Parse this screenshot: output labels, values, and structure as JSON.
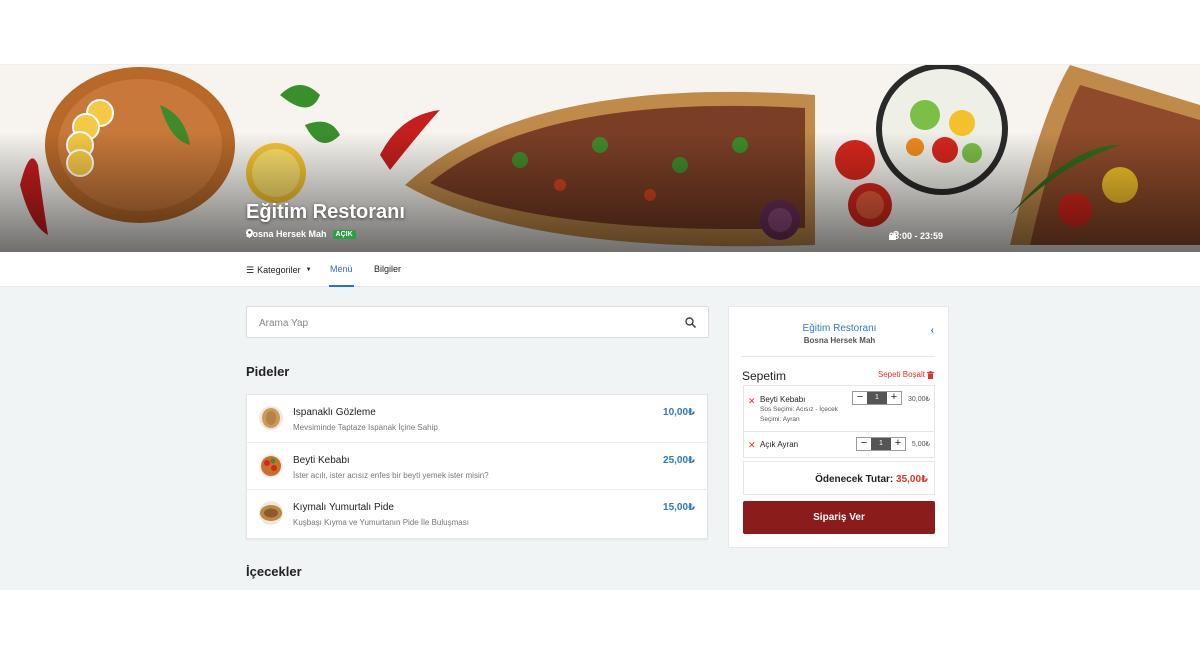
{
  "restaurant": {
    "name": "Eğitim Restoranı",
    "location": "Bosna Hersek Mah",
    "status_badge": "AÇIK",
    "hours": "08:00 - 23:59"
  },
  "nav": {
    "categories": "Kategoriler",
    "menu": "Menü",
    "info": "Bilgiler"
  },
  "search": {
    "placeholder": "Arama Yap"
  },
  "sections": {
    "pides": "Pideler",
    "drinks": "İçecekler"
  },
  "menu_items": [
    {
      "name": "Ispanaklı Gözleme",
      "desc": "Mevsiminde Taptaze Ispanak İçine Sahip",
      "price": "10,00₺"
    },
    {
      "name": "Beyti Kebabı",
      "desc": "İster acılı, ister acısız enfes bir beyti yemek ister misin?",
      "price": "25,00₺"
    },
    {
      "name": "Kıymalı Yumurtalı Pide",
      "desc": "Kuşbaşı Kıyma ve Yumurtanın Pide İle Buluşması",
      "price": "15,00₺"
    }
  ],
  "cart": {
    "restaurant_name": "Eğitim Restoranı",
    "restaurant_location": "Bosna Hersek Mah",
    "back_icon": "‹",
    "title": "Sepetim",
    "clear_label": "Sepeti Boşalt",
    "items": [
      {
        "name": "Beyti Kebabı",
        "option1": "Sos Seçimi: Acısız - İçecek",
        "option2": "Seçimi: Ayran",
        "qty": "1",
        "price": "30,00₺"
      },
      {
        "name": "Açık Ayran",
        "qty": "1",
        "price": "5,00₺"
      }
    ],
    "total_label": "Ödenecek Tutar:",
    "total_value": "35,00₺",
    "order_button": "Sipariş Ver"
  },
  "colors": {
    "accent": "#2f6cd6",
    "price": "#2f78c4",
    "danger": "#dd3333",
    "order_button": "#8a1c1c",
    "open_badge": "#2e9e45"
  }
}
